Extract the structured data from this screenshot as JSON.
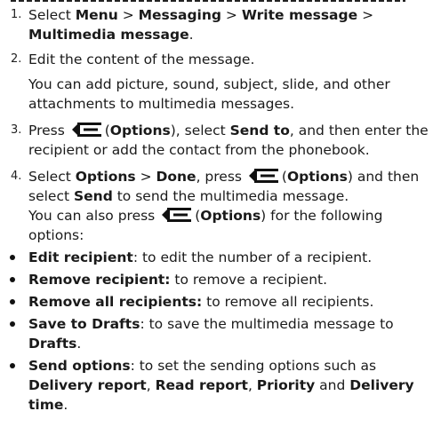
{
  "steps": [
    {
      "num": "1.",
      "p1": "Select ",
      "b1": "Menu",
      "p2": " > ",
      "b2": "Messaging",
      "p3": " > ",
      "b3": "Write message",
      "p4": " > ",
      "b4": "Multimedia message",
      "p5": "."
    },
    {
      "num": "2.",
      "text": "Edit the content of the message."
    },
    {
      "num": "3.",
      "p1": "Press ",
      "b1": "Options",
      "p2": ", select ",
      "b2": "Send to",
      "p3": ", and then enter the recipient or add the contact from the phonebook."
    },
    {
      "num": "4.",
      "p1": "Select ",
      "b1": "Options",
      "p2": " > ",
      "b2": "Done",
      "p3": ", press ",
      "b3": "Options",
      "p4": " and then select ",
      "b4": "Send",
      "p5": " to send the multimedia message."
    }
  ],
  "note_step2": "You can add picture, sound, subject, slide, and other attachments to multimedia messages.",
  "note_step4": {
    "p1": "You can also press ",
    "b1": "Options",
    "p2": " for the following options:"
  },
  "bullets": [
    {
      "b1": "Edit recipient",
      "t1": ": to edit the number of a recipient."
    },
    {
      "b1": "Remove recipient:",
      "t1": " to remove a recipient."
    },
    {
      "b1": "Remove all recipients:",
      "t1": " to remove all recipients."
    },
    {
      "b1": "Save to Drafts",
      "t1": ": to save the multimedia message to ",
      "b2": "Drafts",
      "t2": "."
    },
    {
      "b1": "Send options",
      "t1": ": to set the sending options such as ",
      "b2": "Delivery report",
      "t2": ", ",
      "b3": "Read report",
      "t3": ", ",
      "b4": "Priority",
      "t4": " and ",
      "b5": "Delivery time",
      "t5": "."
    }
  ],
  "icons": {
    "softkey": "left-softkey-icon"
  }
}
